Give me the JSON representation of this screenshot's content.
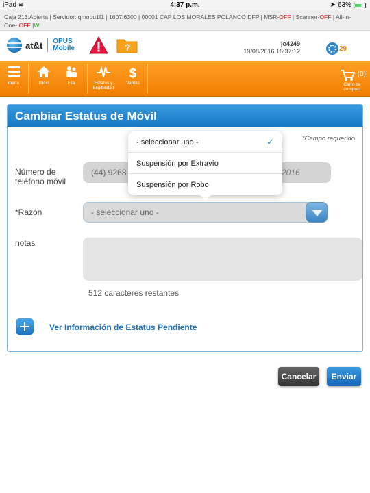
{
  "status_bar": {
    "device": "iPad",
    "time": "4:37 p.m.",
    "battery": "63%",
    "battery_level": 0.63
  },
  "info_bar": {
    "text_line1": "Caja 213:Abierta | Servidor: qmopu1f1 | 1607.6300 | 00001 CAP LOS MORALES POLANCO DFP | MSR-",
    "msr": "OFF",
    "scanner_label": " | Scanner-",
    "scanner": "OFF",
    "allinone_label": " | All-in-",
    "allinone_prefix": "One- ",
    "allinone": "OFF",
    "w_sep": " |",
    "w": "W"
  },
  "header": {
    "brand": "at&t",
    "product_line1": "OPUS",
    "product_line2": "Mobile",
    "username": "jo4249",
    "datetime": "19/08/2016 16:37:12",
    "notification_count": "29",
    "icons": [
      "alert-icon",
      "folder-alert-icon",
      "notification-icon"
    ]
  },
  "nav": {
    "items": [
      {
        "label": "menu",
        "icon": "menu-icon"
      },
      {
        "label": "Inicio",
        "icon": "home-icon"
      },
      {
        "label": "Fila",
        "icon": "queue-icon"
      },
      {
        "label": "Estatus y Eligibilidad",
        "icon": "pulse-icon"
      },
      {
        "label": "Ventas",
        "icon": "dollar-icon"
      }
    ],
    "cart_count": "(0)",
    "cart_label": "Carro de compras"
  },
  "form": {
    "title": "Cambiar Estatus de Móvil",
    "required_note": "*Campo requerido",
    "phone_label": "Número de teléfono móvil",
    "phone_value": "(44) 9268",
    "phone_date": "3/2016",
    "reason_label": "*Razón",
    "reason_value": "- seleccionar uno -",
    "notes_label": "notas",
    "remaining": "512 caracteres restantes",
    "pending_link": "Ver Información de Estatus Pendiente"
  },
  "dropdown": {
    "options": [
      "- seleccionar uno -",
      "Suspensión por Extravío",
      "Suspensión por Robo"
    ],
    "selected_index": 0
  },
  "buttons": {
    "cancel": "Cancelar",
    "send": "Enviar"
  },
  "colors": {
    "accent_blue": "#1a72c0",
    "nav_orange": "#f58a10",
    "off_red": "#d01010",
    "on_green": "#2a9a2a"
  }
}
